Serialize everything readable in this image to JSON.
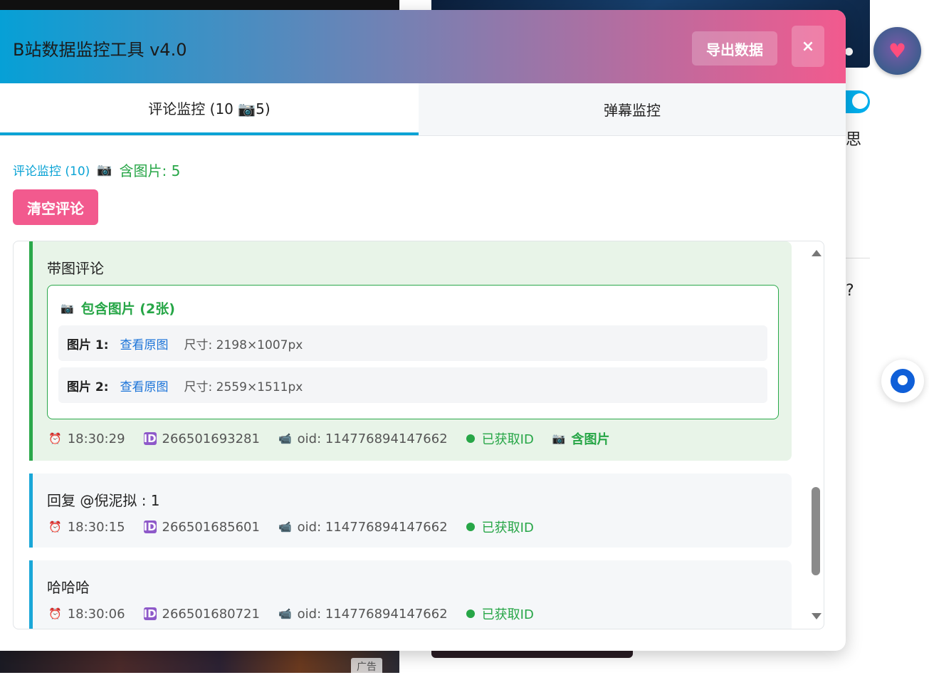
{
  "window": {
    "title": "B站数据监控工具 v4.0",
    "export_label": "导出数据",
    "close_label": "×"
  },
  "tabs": [
    {
      "label": "评论监控 (10 📷5)",
      "active": true
    },
    {
      "label": "弹幕监控",
      "active": false
    }
  ],
  "summary": {
    "comments_label": "评论监控 (10)",
    "camera": "📷",
    "with_images": "含图片: 5"
  },
  "clear_label": "清空评论",
  "comments": [
    {
      "text": "带图评论",
      "has_images": true,
      "images_title": "包含图片 (2张)",
      "images": [
        {
          "label": "图片 1:",
          "link": "查看原图",
          "size": "尺寸: 2198×1007px"
        },
        {
          "label": "图片 2:",
          "link": "查看原图",
          "size": "尺寸: 2559×1511px"
        }
      ],
      "time": "18:30:29",
      "id": "266501693281",
      "oid": "oid: 114776894147662",
      "status": "已获取ID",
      "image_tag": "含图片"
    },
    {
      "text": "回复 @倪泥拟 : 1",
      "has_images": false,
      "time": "18:30:15",
      "id": "266501685601",
      "oid": "oid: 114776894147662",
      "status": "已获取ID"
    },
    {
      "text": "哈哈哈",
      "has_images": false,
      "time": "18:30:06",
      "id": "266501680721",
      "oid": "oid: 114776894147662",
      "status": "已获取ID"
    }
  ],
  "background": {
    "side_text_1": "思",
    "side_text_2": "?",
    "ad_tag": "广告"
  },
  "colors": {
    "header_start": "#06a0d6",
    "header_end": "#f25a8e",
    "accent": "#0aa3d5",
    "pink": "#f25a8e",
    "green": "#27a647"
  },
  "icons": {
    "time": "alarm-clock-icon",
    "id": "id-badge-icon",
    "oid": "video-camera-icon",
    "status": "green-dot-icon",
    "image": "camera-icon"
  }
}
